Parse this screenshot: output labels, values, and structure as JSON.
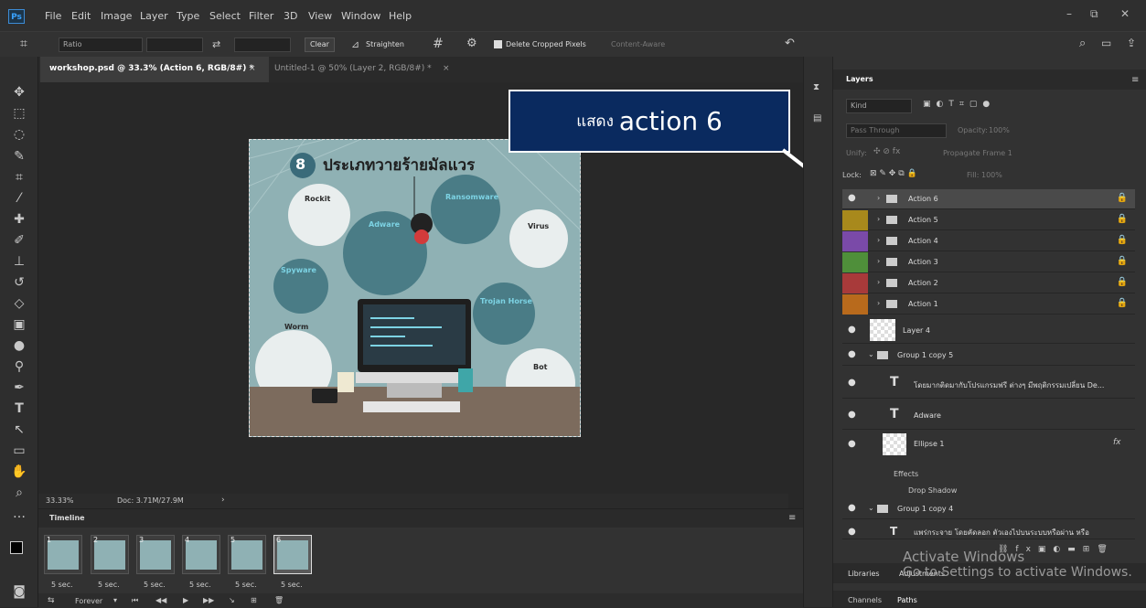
{
  "app": {
    "logo": "Ps"
  },
  "menu": [
    "File",
    "Edit",
    "Image",
    "Layer",
    "Type",
    "Select",
    "Filter",
    "3D",
    "View",
    "Window",
    "Help"
  ],
  "options": {
    "ratio": "Ratio",
    "clear": "Clear",
    "straighten": "Straighten",
    "delete_cropped": "Delete Cropped Pixels",
    "content_aware": "Content-Aware"
  },
  "tabs": [
    {
      "label": "workshop.psd @ 33.3% (Action 6, RGB/8#) *"
    },
    {
      "label": "Untitled-1 @ 50% (Layer 2, RGB/8#) *"
    }
  ],
  "status": {
    "zoom": "33.33%",
    "doc": "Doc: 3.71M/27.9M"
  },
  "timeline": {
    "title": "Timeline",
    "frames": [
      {
        "num": "1",
        "delay": "5 sec."
      },
      {
        "num": "2",
        "delay": "5 sec."
      },
      {
        "num": "3",
        "delay": "5 sec."
      },
      {
        "num": "4",
        "delay": "5 sec."
      },
      {
        "num": "5",
        "delay": "5 sec."
      },
      {
        "num": "6",
        "delay": "5 sec."
      }
    ],
    "loop": "Forever"
  },
  "layers_panel": {
    "tab": "Layers",
    "filter": "Kind",
    "blend": "Pass Through",
    "opacity_label": "Opacity:",
    "opacity": "100%",
    "unify": "Unify:",
    "propagate": "Propagate Frame 1",
    "lock": "Lock:",
    "fill_label": "Fill:",
    "fill": "100%",
    "layers": [
      {
        "name": "Action 6",
        "color": "#4a4a4a"
      },
      {
        "name": "Action 5",
        "color": "#a8891c"
      },
      {
        "name": "Action 4",
        "color": "#7a4aa8"
      },
      {
        "name": "Action 3",
        "color": "#4f8f3a"
      },
      {
        "name": "Action 2",
        "color": "#a83a3a"
      },
      {
        "name": "Action 1",
        "color": "#b86a1c"
      }
    ],
    "layer4": "Layer 4",
    "group5": "Group 1 copy 5",
    "text_layer": "โดยมากติดมากับโปรแกรมฟรี ต่างๆ มีพฤติกรรมเปลี่ยน De...",
    "adware": "Adware",
    "ellipse": "Ellipse 1",
    "effects": "Effects",
    "drop_shadow": "Drop Shadow",
    "group4": "Group 1 copy 4",
    "text_layer2": "แพร่กระจาย โดยคัดลอก ตัวเองไปบนระบบหรือผ่าน หรือ",
    "bottom_tabs": [
      "Libraries",
      "Adjustments"
    ],
    "bottom_tabs2": [
      "Channels",
      "Paths"
    ]
  },
  "callout": {
    "thai": "แสดง",
    "text": "action  6"
  },
  "watermark": {
    "line1": "Activate Windows",
    "line2": "Go to Settings to activate Windows."
  },
  "artwork": {
    "title_num": "8",
    "title": "ประเภทวายร้ายมัลแวร",
    "bubbles": [
      "Rockit",
      "Adware",
      "Ransomware",
      "Virus",
      "Spyware",
      "Trojan Horse",
      "Worm",
      "Bot"
    ]
  }
}
